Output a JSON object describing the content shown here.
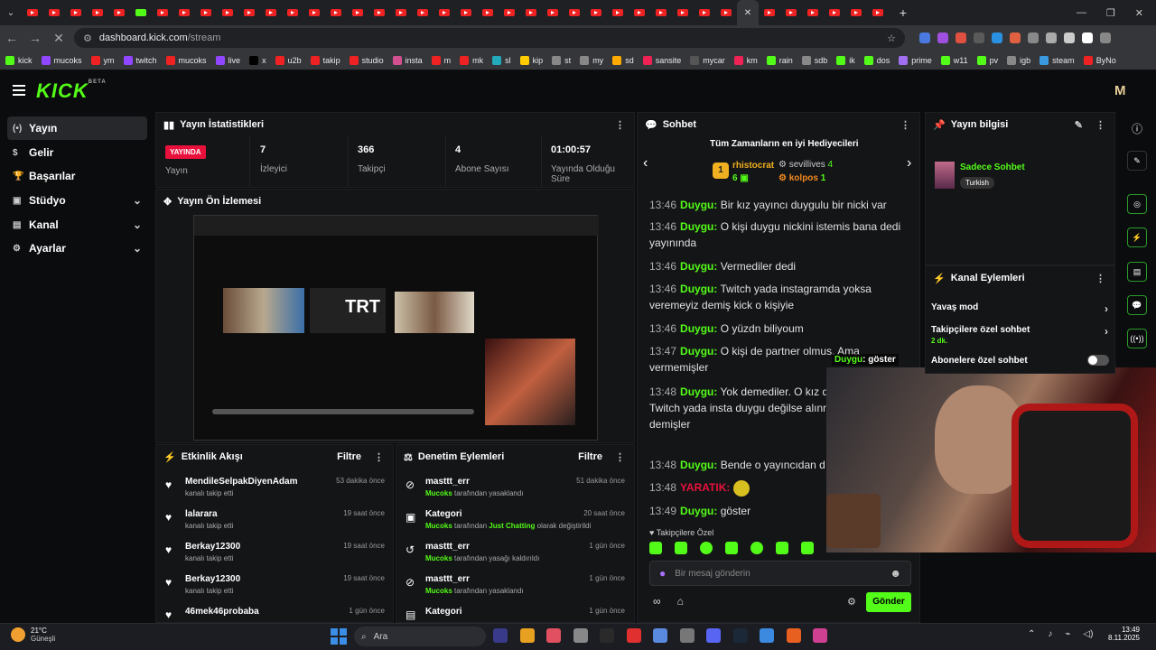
{
  "browser": {
    "url_host": "dashboard.kick.com",
    "url_path": "/stream",
    "bookmarks": [
      "kick",
      "mucoks",
      "ym",
      "twitch",
      "mucoks",
      "live",
      "x",
      "u2b",
      "takip",
      "studio",
      "insta",
      "m",
      "mk",
      "sl",
      "kip",
      "st",
      "my",
      "sd",
      "sansite",
      "mycar",
      "km",
      "rain",
      "sdb",
      "ik",
      "dos",
      "prime",
      "w11",
      "pv",
      "igb",
      "steam",
      "ByNo"
    ]
  },
  "header": {
    "logo": "KICK",
    "logo_badge": "BETA"
  },
  "sidebar": {
    "items": [
      {
        "label": "Yayın",
        "icon": "(•)"
      },
      {
        "label": "Gelir",
        "icon": "$"
      },
      {
        "label": "Başarılar",
        "icon": "🏆"
      },
      {
        "label": "Stüdyo",
        "icon": "▣"
      },
      {
        "label": "Kanal",
        "icon": "▤"
      },
      {
        "label": "Ayarlar",
        "icon": "⚙"
      }
    ]
  },
  "stats": {
    "title": "Yayın İstatistikleri",
    "live_badge": "YAYINDA",
    "live_label": "Yayın",
    "viewers": "7",
    "viewers_label": "İzleyici",
    "followers": "366",
    "followers_label": "Takipçi",
    "subs": "4",
    "subs_label": "Abone Sayısı",
    "uptime": "01:00:57",
    "uptime_label": "Yayında Olduğu Süre"
  },
  "preview": {
    "title": "Yayın Ön İzlemesi",
    "trt_text": "TRT"
  },
  "activity": {
    "title": "Etkinlik Akışı",
    "filter": "Filtre",
    "items": [
      {
        "name": "MendileSelpakDiyenAdam",
        "sub": "kanalı takip etti",
        "time": "53 dakika önce"
      },
      {
        "name": "lalarara",
        "sub": "kanalı takip etti",
        "time": "19 saat önce"
      },
      {
        "name": "Berkay12300",
        "sub": "kanalı takip etti",
        "time": "19 saat önce"
      },
      {
        "name": "Berkay12300",
        "sub": "kanalı takip etti",
        "time": "19 saat önce"
      },
      {
        "name": "46mek46probaba",
        "sub": "",
        "time": "1 gün önce"
      }
    ]
  },
  "moderation": {
    "title": "Denetim Eylemleri",
    "filter": "Filtre",
    "items": [
      {
        "name": "masttt_err",
        "by": "Mucoks",
        "sub": "tarafından yasaklandı",
        "time": "51 dakika önce"
      },
      {
        "name": "Kategori",
        "by": "Mucoks",
        "sub": "tarafından",
        "extra": "Just Chatting",
        "sub2": "olarak değiştirildi",
        "time": "20 saat önce"
      },
      {
        "name": "masttt_err",
        "by": "Mucoks",
        "sub": "tarafından yasağı kaldırıldı",
        "time": "1 gün önce"
      },
      {
        "name": "masttt_err",
        "by": "Mucoks",
        "sub": "tarafından yasaklandı",
        "time": "1 gün önce"
      },
      {
        "name": "Kategori",
        "by": "",
        "sub": "",
        "time": "1 gün önce"
      }
    ]
  },
  "chat": {
    "title": "Sohbet",
    "gifters_title": "Tüm Zamanların en iyi Hediyecileri",
    "top1": {
      "name": "rhistocrat",
      "count": "6"
    },
    "top2": {
      "name": "sevillives",
      "count": "4"
    },
    "top3": {
      "name": "kolpos",
      "count": "1"
    },
    "messages": [
      {
        "time": "13:46",
        "user": "Duygu",
        "text": "Bir kız yayıncı duygulu bir nicki var"
      },
      {
        "time": "13:46",
        "user": "Duygu",
        "text": "O kişi duygu nickini istemis bana dedi yayınında"
      },
      {
        "time": "13:46",
        "user": "Duygu",
        "text": "Vermediler dedi"
      },
      {
        "time": "13:46",
        "user": "Duygu",
        "text": "Twitch yada instagramda yoksa veremeyiz demiş kick o kişiyie"
      },
      {
        "time": "13:46",
        "user": "Duygu",
        "text": "O yüzdn biliyoum"
      },
      {
        "time": "13:47",
        "user": "Duygu",
        "text": "O kişi de partner olmus. Ama vermemişler"
      },
      {
        "time": "13:48",
        "user": "Duygu",
        "text": "Yok demediler. O kız demişler sadece. Twitch yada insta duygu değilse alınmış bir nicki değ demişler"
      },
      {
        "time": "13:48",
        "user": "Duygu",
        "text": "Bende o yayıncıdan d"
      },
      {
        "time": "13:48",
        "user": "YARATIK",
        "text": ""
      },
      {
        "time": "13:49",
        "user": "Duygu",
        "text": "göster"
      }
    ],
    "overlay_user": "Duygu",
    "overlay_text": ": göster",
    "followers_only": "Takipçilere Özel",
    "input_placeholder": "Bir mesaj gönderin",
    "send": "Gönder"
  },
  "info": {
    "title": "Yayın bilgisi",
    "stream_title": "Sadece Sohbet",
    "tag": "Turkish"
  },
  "channel_actions": {
    "title": "Kanal Eylemleri",
    "slow": "Yavaş mod",
    "followers_chat": "Takipçilere özel sohbet",
    "followers_time": "2 dk.",
    "subs_chat": "Abonelere özel sohbet"
  },
  "taskbar": {
    "weather_temp": "21°C",
    "weather_desc": "Güneşli",
    "search": "Ara",
    "time": "13:49",
    "date": "8.11.2025"
  },
  "colors": {
    "accent": "#53fc18",
    "live": "#e9113c"
  }
}
